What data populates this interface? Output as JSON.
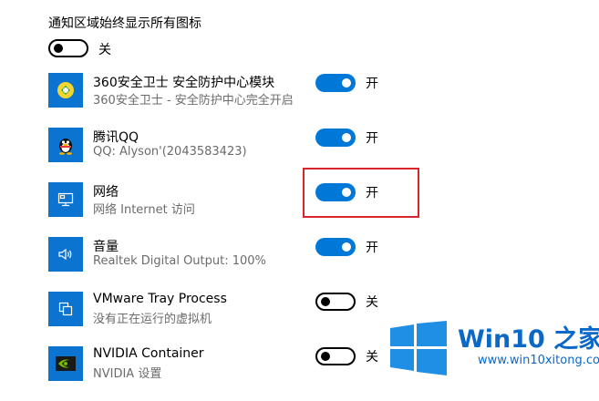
{
  "section": {
    "title": "通知区域始终显示所有图标",
    "master_toggle": {
      "state": "off",
      "label": "关"
    }
  },
  "apps": [
    {
      "icon": "360-shield-icon",
      "name": "360安全卫士 安全防护中心模块",
      "desc": "360安全卫士 - 安全防护中心完全开启",
      "state": "on",
      "label": "开"
    },
    {
      "icon": "qq-penguin-icon",
      "name": "腾讯QQ",
      "desc": "QQ: Alyson'(2043583423)",
      "state": "on",
      "label": "开"
    },
    {
      "icon": "network-monitor-icon",
      "name": "网络",
      "desc": "网络 Internet 访问",
      "state": "on",
      "label": "开"
    },
    {
      "icon": "speaker-icon",
      "name": "音量",
      "desc": "Realtek Digital Output: 100%",
      "state": "on",
      "label": "开"
    },
    {
      "icon": "vmware-icon",
      "name": "VMware Tray Process",
      "desc": "没有正在运行的虚拟机",
      "state": "off",
      "label": "关"
    },
    {
      "icon": "nvidia-icon",
      "name": "NVIDIA Container",
      "desc": "NVIDIA 设置",
      "state": "off",
      "label": "关"
    }
  ],
  "watermark": {
    "title": "Win10 之家",
    "url": "www.win10xitong.com"
  },
  "colors": {
    "accent": "#0078d7",
    "highlight": "#d9262a",
    "icon_bg": "#0a74d0"
  }
}
